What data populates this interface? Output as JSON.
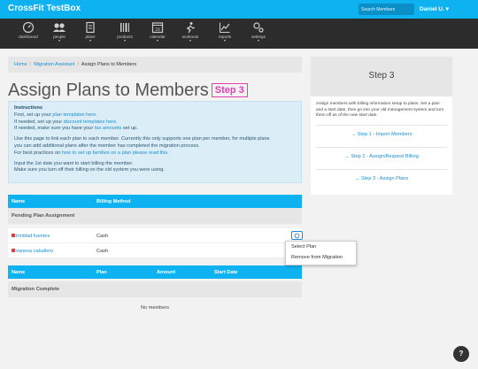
{
  "app": {
    "brand": "CrossFit TestBox",
    "search_placeholder": "Search Members",
    "user": "Daniel U. ▾"
  },
  "nav": [
    {
      "label": "dashboard",
      "icon": "dashboard-icon"
    },
    {
      "label": "people",
      "icon": "people-icon",
      "caret": "▾"
    },
    {
      "label": "plans",
      "icon": "plans-icon",
      "caret": "▾"
    },
    {
      "label": "products",
      "icon": "products-icon",
      "caret": "▾"
    },
    {
      "label": "calendar",
      "icon": "calendar-icon",
      "caret": "▾",
      "day": "16"
    },
    {
      "label": "workouts",
      "icon": "workouts-icon",
      "caret": "▾"
    },
    {
      "label": "reports",
      "icon": "reports-icon",
      "caret": "▾"
    },
    {
      "label": "settings",
      "icon": "settings-icon",
      "caret": "▾"
    }
  ],
  "breadcrumb": {
    "home": "Home",
    "migration": "Migration Assistant",
    "current": "Assign Plans to Members",
    "sep": "/"
  },
  "page": {
    "title": "Assign Plans to Members",
    "step_badge": "Step 3"
  },
  "instructions": {
    "title": "Instructions",
    "line1_pre": "First, set up your ",
    "line1_link": "plan templates here.",
    "line2_pre": "If needed, set up your ",
    "line2_link": "discount templates here.",
    "line3_pre": "If needed, make sure you have your ",
    "line3_link": "tax amounts",
    "line3_post": " set up.",
    "line4": "Use this page to link each plan to each member. Currently this only supports one plan per member, for multiple plans",
    "line5": "you can add additional plans after the member has completed the migration process.",
    "line6_pre": "For best practices on ",
    "line6_link": "how to set up families on a plan please read this.",
    "line7": "Input the 1st date you want to start billing the member.",
    "line8": "Make sure you turn off their billing on the old system you were using."
  },
  "pending": {
    "headers": {
      "name": "Name",
      "billing": "Billing Method"
    },
    "section_title": "Pending Plan Assignment",
    "rows": [
      {
        "name": "trinidad fuentes",
        "method": "Cash"
      },
      {
        "name": "vanesa caballero",
        "method": "Cash"
      }
    ]
  },
  "context_menu": {
    "select": "Select Plan",
    "remove": "Remove from Migration"
  },
  "complete": {
    "headers": {
      "name": "Name",
      "plan": "Plan",
      "amount": "Amount",
      "start": "Start Date"
    },
    "section_title": "Migration Complete",
    "empty": "No members"
  },
  "sidebar": {
    "title": "Step 3",
    "description": "Assign members with billing information setup to plans. Set a plan and a start date, then go into your old management system and turn them off as of the new start date.",
    "links": [
      "→  Step 1 - Import Members",
      "→  Step 2 - Assign/Request Billing",
      "→  Step 3 - Assign Plans"
    ]
  },
  "help": {
    "label": "?"
  },
  "colors": {
    "brand_blue": "#0eb2f0",
    "nav_bg": "#2c2c2c",
    "step_pink": "#e23fb2",
    "status_red": "#e23c3c",
    "link": "#1a8dd0"
  }
}
